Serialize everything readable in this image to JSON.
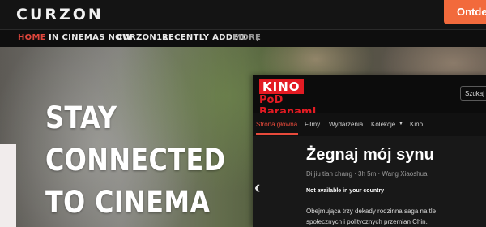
{
  "curzon": {
    "logo": "CURZON",
    "header_button": "Ontdek",
    "nav": {
      "home": "HOME",
      "in_cinemas_now": "IN CINEMAS NOW",
      "curzon12": "CURZON12",
      "recently_added": "RECENTLY ADDED",
      "more": "MORE",
      "more_icon": "chevron-right-icon"
    },
    "hero": {
      "line1": "STAY",
      "line2": "CONNECTED",
      "line3": "TO CINEMA"
    },
    "colors": {
      "accent": "#e0463c",
      "header_bg": "#141414",
      "button": "#f26a3c"
    }
  },
  "kino": {
    "logo_word": "KINO",
    "logo_sub": "PoD BaranamI",
    "search_label": "Szukaj",
    "nav": {
      "home": "Strona główna",
      "films": "Filmy",
      "events": "Wydarzenia",
      "collections": "Kolekcje",
      "collections_icon": "caret-down-icon",
      "kino": "Kino"
    },
    "film": {
      "title": "Żegnaj mój synu",
      "meta": "Di jiu tian chang  ·  3h 5m  ·  Wang Xiaoshuai",
      "availability": "Not available in your country",
      "desc_line1": "Obejmująca trzy dekady rodzinna saga na tle",
      "desc_line2": "społecznych i politycznych przemian Chin."
    },
    "prev_icon": "chevron-left-icon",
    "colors": {
      "accent": "#e31b23",
      "nav_active": "#e84a3b",
      "bg": "#111111"
    }
  }
}
